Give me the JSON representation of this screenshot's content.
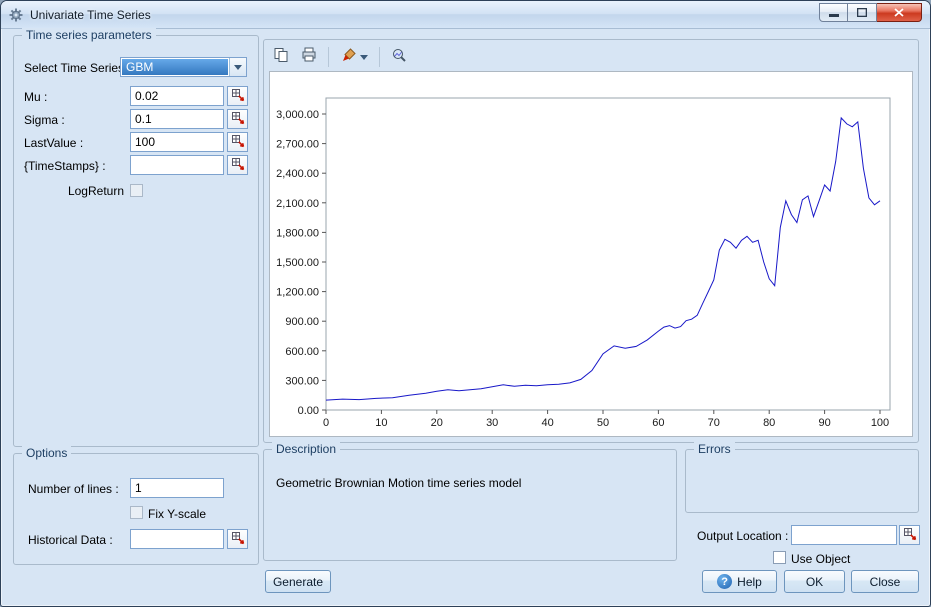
{
  "window": {
    "title": "Univariate Time Series"
  },
  "params": {
    "group_label": "Time series parameters",
    "select": {
      "label": "Select Time Series:",
      "value": "GBM"
    },
    "mu": {
      "label": "Mu :",
      "value": "0.02"
    },
    "sigma": {
      "label": "Sigma :",
      "value": "0.1"
    },
    "lastvalue": {
      "label": "LastValue :",
      "value": "100"
    },
    "timestamps": {
      "label": "{TimeStamps} :",
      "value": ""
    },
    "logreturn": {
      "label": "LogReturn",
      "checked": false
    }
  },
  "options": {
    "group_label": "Options",
    "number_of_lines": {
      "label": "Number of lines :",
      "value": "1"
    },
    "fix_yscale": {
      "label": "Fix Y-scale",
      "checked": false
    },
    "historical": {
      "label": "Historical Data :",
      "value": ""
    }
  },
  "description": {
    "group_label": "Description",
    "text": "Geometric Brownian Motion time series model"
  },
  "errors": {
    "group_label": "Errors"
  },
  "output": {
    "label": "Output Location :",
    "value": "",
    "use_object_label": "Use Object",
    "use_object_checked": false
  },
  "buttons": {
    "generate": "Generate",
    "help": "Help",
    "help_icon": "?",
    "ok": "OK",
    "close": "Close"
  },
  "colors": {
    "dialog_bg": "#d7e5f4",
    "combo_highlight": "#3478bf",
    "close_button": "#cc3a20"
  },
  "chart_data": {
    "type": "line",
    "title": "",
    "xlabel": "",
    "ylabel": "",
    "grid": false,
    "legend": false,
    "line_color": "#1818c8",
    "xlim": [
      0,
      100
    ],
    "ylim": [
      0,
      3000
    ],
    "xticks": [
      0,
      10,
      20,
      30,
      40,
      50,
      60,
      70,
      80,
      90,
      100
    ],
    "yticks": [
      0,
      300,
      600,
      900,
      1200,
      1500,
      1800,
      2100,
      2400,
      2700,
      3000
    ],
    "ytick_labels": [
      "0.00",
      "300.00",
      "600.00",
      "900.00",
      "1,200.00",
      "1,500.00",
      "1,800.00",
      "2,100.00",
      "2,400.00",
      "2,700.00",
      "3,000.00"
    ],
    "series": [
      {
        "name": "GBM",
        "x": [
          0,
          3,
          6,
          9,
          12,
          15,
          18,
          20,
          22,
          24,
          26,
          28,
          30,
          32,
          34,
          36,
          38,
          40,
          42,
          44,
          46,
          48,
          50,
          52,
          54,
          56,
          58,
          60,
          61,
          62,
          63,
          64,
          65,
          66,
          67,
          68,
          69,
          70,
          71,
          72,
          73,
          74,
          75,
          76,
          77,
          78,
          79,
          80,
          81,
          82,
          83,
          84,
          85,
          86,
          87,
          88,
          89,
          90,
          91,
          92,
          93,
          94,
          95,
          96,
          97,
          98,
          99,
          100
        ],
        "y": [
          100,
          110,
          105,
          118,
          125,
          150,
          170,
          190,
          205,
          195,
          205,
          215,
          235,
          255,
          240,
          250,
          245,
          255,
          260,
          275,
          310,
          400,
          570,
          650,
          625,
          645,
          710,
          800,
          840,
          855,
          830,
          845,
          905,
          920,
          960,
          1080,
          1200,
          1320,
          1620,
          1730,
          1700,
          1640,
          1720,
          1760,
          1700,
          1720,
          1500,
          1330,
          1260,
          1850,
          2120,
          1980,
          1900,
          2130,
          2170,
          1960,
          2120,
          2280,
          2220,
          2520,
          2960,
          2900,
          2870,
          2920,
          2450,
          2150,
          2080,
          2120
        ]
      }
    ]
  }
}
